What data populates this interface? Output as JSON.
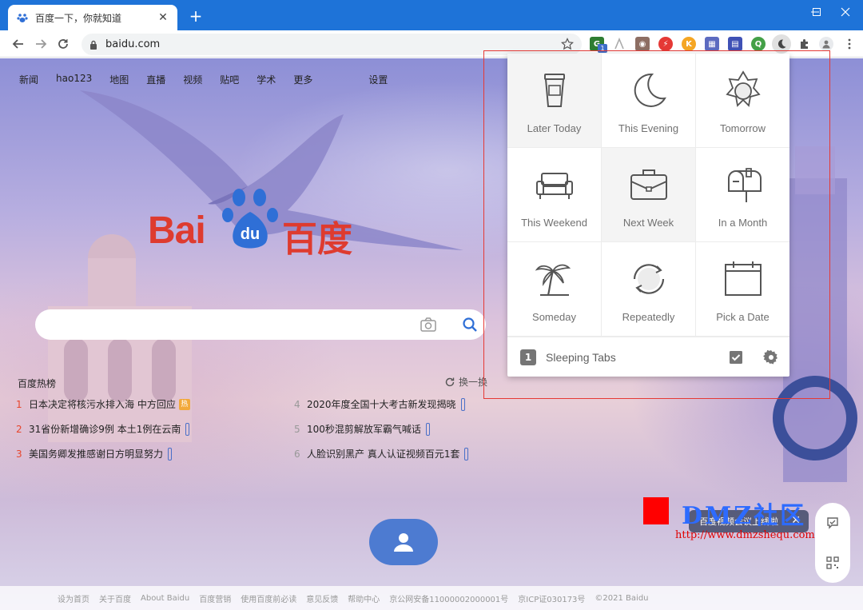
{
  "browser": {
    "tab_title": "百度一下，你就知道",
    "tab_close": "✕",
    "new_tab": "+",
    "url": "baidu.com",
    "ext_badge": "1"
  },
  "baidu": {
    "nav": [
      "新闻",
      "hao123",
      "地图",
      "直播",
      "视频",
      "贴吧",
      "学术",
      "更多"
    ],
    "settings": "设置",
    "logo_bai": "Bai",
    "logo_du": "du",
    "logo_cn": "百度",
    "hot_title": "百度热榜",
    "hot_refresh": "换一换",
    "hot_items": [
      {
        "num": "1",
        "text": "日本决定将核污水排入海 中方回应",
        "badge": "热"
      },
      {
        "num": "2",
        "text": "31省份新增确诊9例 本土1例在云南"
      },
      {
        "num": "3",
        "text": "美国务卿发推感谢日方明显努力"
      },
      {
        "num": "4",
        "text": "2020年度全国十大考古新发现揭晓"
      },
      {
        "num": "5",
        "text": "100秒混剪解放军霸气喊话"
      },
      {
        "num": "6",
        "text": "人脸识别黑产 真人认证视频百元1套"
      }
    ],
    "toast": "百度视频会议上线啦",
    "footer": [
      "设为首页",
      "关于百度",
      "About Baidu",
      "百度营销",
      "使用百度前必读",
      "意见反馈",
      "帮助中心",
      "京公网安备11000002000001号",
      "京ICP证030173号",
      "©2021 Baidu"
    ]
  },
  "snooze": {
    "options": [
      {
        "label": "Later Today",
        "icon": "coffee-cup-icon"
      },
      {
        "label": "This Evening",
        "icon": "moon-icon"
      },
      {
        "label": "Tomorrow",
        "icon": "sun-icon"
      },
      {
        "label": "This Weekend",
        "icon": "sofa-icon"
      },
      {
        "label": "Next Week",
        "icon": "briefcase-icon"
      },
      {
        "label": "In a Month",
        "icon": "mailbox-icon"
      },
      {
        "label": "Someday",
        "icon": "palm-tree-icon"
      },
      {
        "label": "Repeatedly",
        "icon": "repeat-icon"
      },
      {
        "label": "Pick a Date",
        "icon": "calendar-icon"
      }
    ],
    "sleeping_count": "1",
    "sleeping_label": "Sleeping Tabs"
  },
  "watermark": {
    "text": "DMZ社区",
    "url": "http://www.dmzshequ.com"
  },
  "colors": {
    "chrome_blue": "#1e73d8",
    "baidu_red": "#de3b2f",
    "baidu_blue": "#2f6fd6",
    "highlight_frame": "#e53935"
  }
}
